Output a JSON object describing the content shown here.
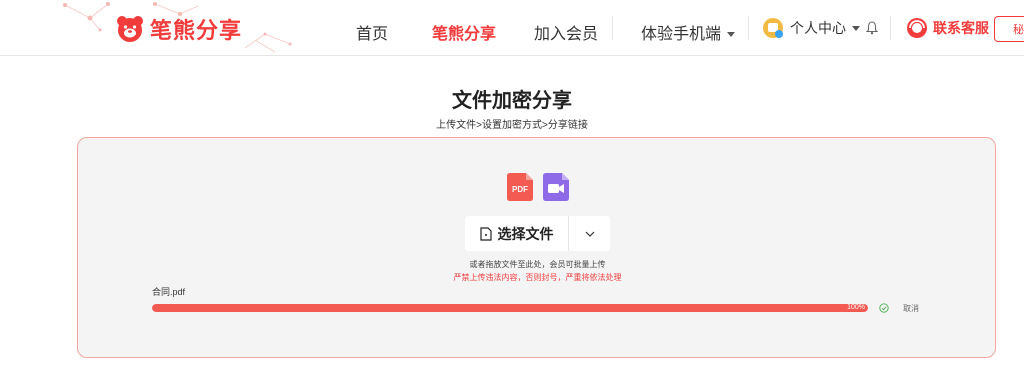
{
  "brand": {
    "name": "笔熊分享",
    "color": "#f23c3c"
  },
  "nav": {
    "items": [
      "首页",
      "笔熊分享",
      "加入会员"
    ],
    "active_index": 1,
    "mobile": "体验手机端",
    "user_center": "个人中心",
    "support": "联系客服",
    "side_tab": "秘"
  },
  "page": {
    "title": "文件加密分享",
    "steps": "上传文件>设置加密方式>分享链接"
  },
  "upload": {
    "file_icons": [
      "pdf-icon",
      "video-icon"
    ],
    "pdf_label": "PDF",
    "select_label": "选择文件",
    "hint": "或者拖放文件至此处，会员可批量上传",
    "warning": "严禁上传违法内容，否则封号，严重将依法处理",
    "file_name": "合同.pdf",
    "progress_percent": 100,
    "progress_text": "100%",
    "cancel_label": "取消"
  }
}
